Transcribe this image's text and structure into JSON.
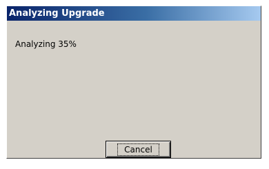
{
  "window": {
    "title": "Analyzing Upgrade",
    "title_gradient_start": "#0a246a",
    "title_gradient_end": "#a6caf0",
    "background": "#d4d0c8"
  },
  "status": {
    "text": "Analyzing 35%"
  },
  "buttons": {
    "cancel_label": "Cancel"
  }
}
